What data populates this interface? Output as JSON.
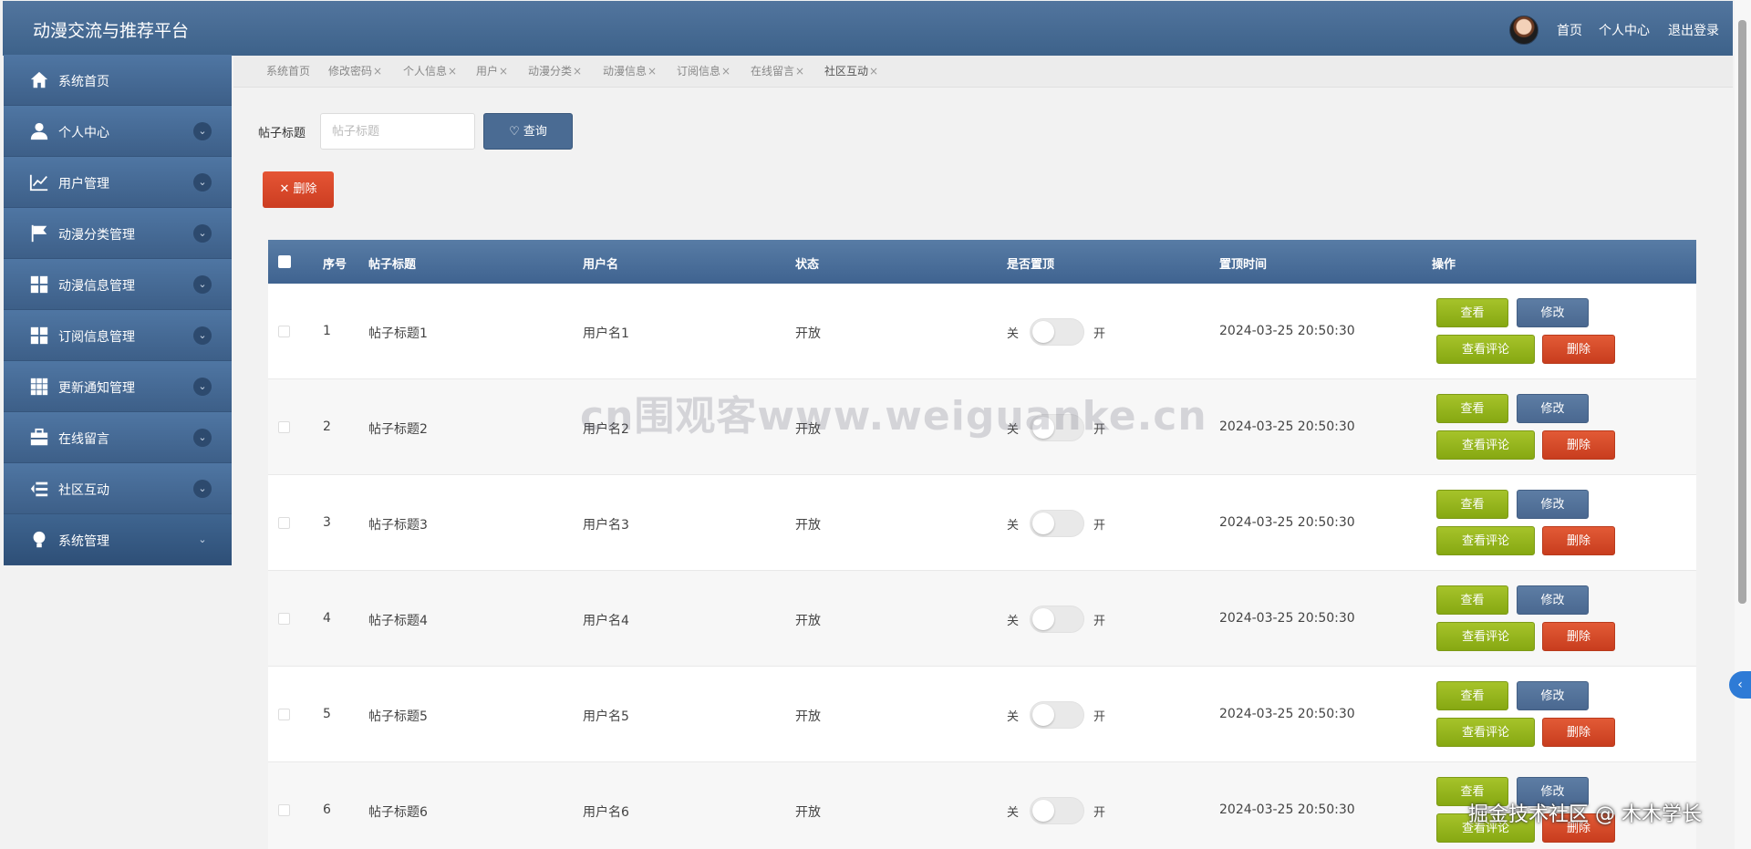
{
  "app": {
    "title": "动漫交流与推荐平台"
  },
  "header": {
    "home": "首页",
    "profile": "个人中心",
    "logout": "退出登录"
  },
  "sidebar": {
    "items": [
      {
        "label": "系统首页",
        "icon": "home-icon"
      },
      {
        "label": "个人中心",
        "icon": "user-icon"
      },
      {
        "label": "用户管理",
        "icon": "chart-icon"
      },
      {
        "label": "动漫分类管理",
        "icon": "flag-icon"
      },
      {
        "label": "动漫信息管理",
        "icon": "grid-icon"
      },
      {
        "label": "订阅信息管理",
        "icon": "grid-icon"
      },
      {
        "label": "更新通知管理",
        "icon": "apps-icon"
      },
      {
        "label": "在线留言",
        "icon": "briefcase-icon"
      },
      {
        "label": "社区互动",
        "icon": "list-icon"
      },
      {
        "label": "系统管理",
        "icon": "bulb-icon"
      }
    ]
  },
  "tags": [
    "系统首页",
    "修改密码",
    "个人信息",
    "用户",
    "动漫分类",
    "动漫信息",
    "订阅信息",
    "在线留言",
    "社区互动"
  ],
  "search": {
    "label": "帖子标题",
    "placeholder": "帖子标题",
    "button": "查询"
  },
  "toolbar": {
    "delete": "删除"
  },
  "table": {
    "headers": [
      "序号",
      "帖子标题",
      "用户名",
      "状态",
      "是否置顶",
      "置顶时间",
      "操作"
    ],
    "rows": [
      {
        "no": "1",
        "title": "帖子标题1",
        "user": "用户名1",
        "status": "开放",
        "top_time": "2024-03-25 20:50:30"
      },
      {
        "no": "2",
        "title": "帖子标题2",
        "user": "用户名2",
        "status": "开放",
        "top_time": "2024-03-25 20:50:30"
      },
      {
        "no": "3",
        "title": "帖子标题3",
        "user": "用户名3",
        "status": "开放",
        "top_time": "2024-03-25 20:50:30"
      },
      {
        "no": "4",
        "title": "帖子标题4",
        "user": "用户名4",
        "status": "开放",
        "top_time": "2024-03-25 20:50:30"
      },
      {
        "no": "5",
        "title": "帖子标题5",
        "user": "用户名5",
        "status": "开放",
        "top_time": "2024-03-25 20:50:30"
      },
      {
        "no": "6",
        "title": "帖子标题6",
        "user": "用户名6",
        "status": "开放",
        "top_time": "2024-03-25 20:50:30"
      }
    ],
    "switch_off": "关",
    "switch_on": "开",
    "actions": {
      "view": "查看",
      "edit": "修改",
      "comments": "查看评论",
      "delete": "删除"
    }
  },
  "watermarks": {
    "center": "cn围观客www.weiguanke.cn",
    "corner": "掘金技术社区 @ 木木学长"
  },
  "colors": {
    "header": "#4a6f99",
    "green": "#94b41c",
    "blue": "#4f6f96",
    "red": "#d44a27"
  }
}
